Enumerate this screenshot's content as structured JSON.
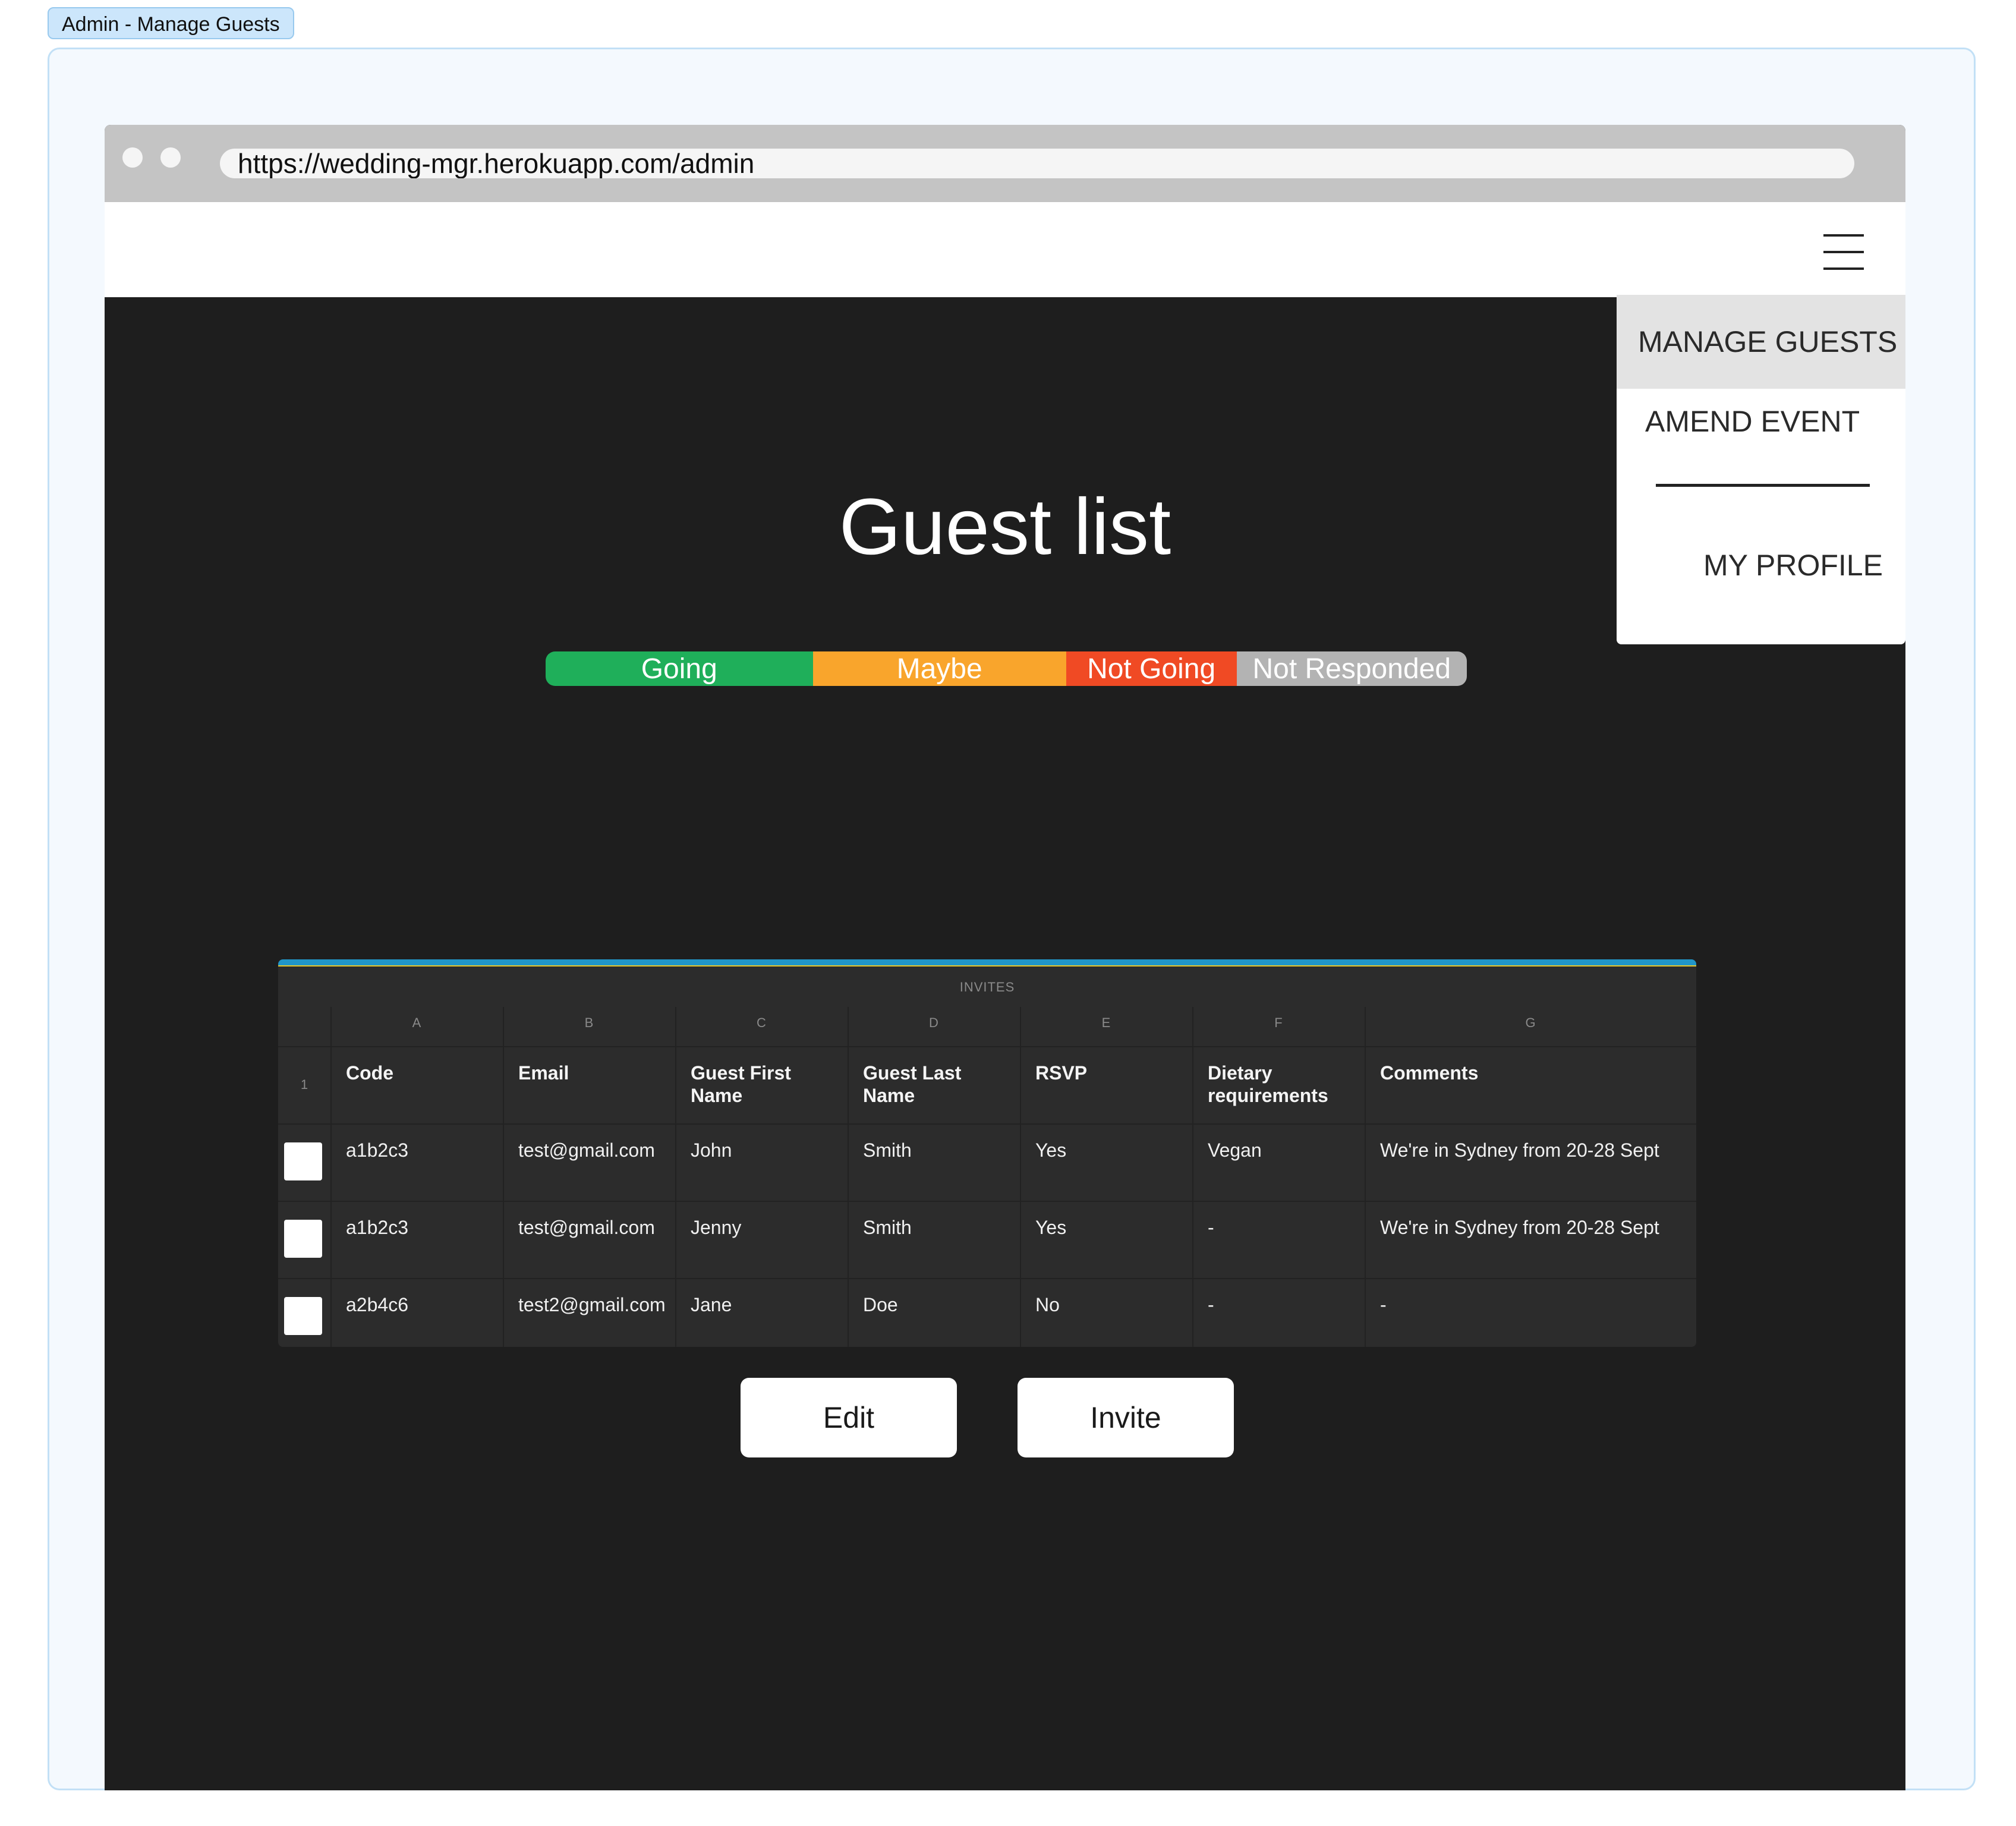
{
  "frame": {
    "label": "Admin - Manage Guests"
  },
  "browser": {
    "url": "https://wedding-mgr.herokuapp.com/admin"
  },
  "menu": {
    "items": [
      {
        "label": "MANAGE GUESTS",
        "active": true
      },
      {
        "label": "AMEND EVENT"
      },
      {
        "label": "MY PROFILE"
      }
    ]
  },
  "page": {
    "title": "Guest list"
  },
  "status_bar": {
    "segments": [
      {
        "label": "Going",
        "color": "#1faf5a",
        "share": 0.29
      },
      {
        "label": "Maybe",
        "color": "#f9a52c",
        "share": 0.275
      },
      {
        "label": "Not  Going",
        "color": "#f04a24",
        "share": 0.185
      },
      {
        "label": "Not  Responded",
        "color": "#b3b3b3",
        "share": 0.25
      }
    ]
  },
  "sheet": {
    "title": "INVITES",
    "columns": [
      "A",
      "B",
      "C",
      "D",
      "E",
      "F",
      "G"
    ],
    "header_row_number": "1",
    "headers": [
      "Code",
      "Email",
      "Guest First Name",
      "Guest Last Name",
      "RSVP",
      "Dietary requirements",
      "Comments"
    ],
    "rows": [
      [
        "a1b2c3",
        "test@gmail.com",
        "John",
        "Smith",
        "Yes",
        "Vegan",
        "We're in Sydney from 20-28 Sept"
      ],
      [
        "a1b2c3",
        "test@gmail.com",
        "Jenny",
        "Smith",
        "Yes",
        "-",
        "We're in Sydney from 20-28 Sept"
      ],
      [
        "a2b4c6",
        "test2@gmail.com",
        "Jane",
        "Doe",
        "No",
        "-",
        "-"
      ]
    ]
  },
  "actions": {
    "edit_label": "Edit",
    "invite_label": "Invite"
  }
}
